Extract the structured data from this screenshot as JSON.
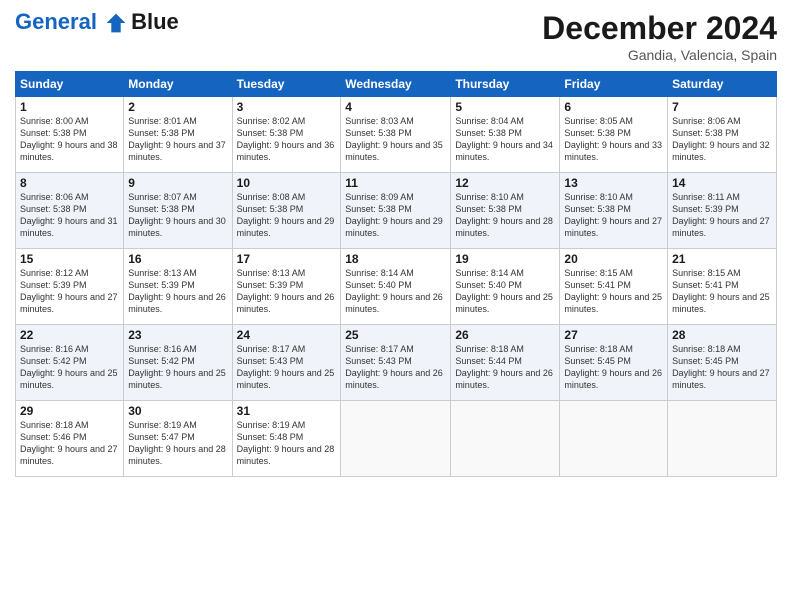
{
  "header": {
    "logo_line1": "General",
    "logo_line2": "Blue",
    "main_title": "December 2024",
    "subtitle": "Gandia, Valencia, Spain"
  },
  "calendar": {
    "days_of_week": [
      "Sunday",
      "Monday",
      "Tuesday",
      "Wednesday",
      "Thursday",
      "Friday",
      "Saturday"
    ],
    "weeks": [
      [
        {
          "day": "",
          "empty": true
        },
        {
          "day": "",
          "empty": true
        },
        {
          "day": "",
          "empty": true
        },
        {
          "day": "",
          "empty": true
        },
        {
          "day": "",
          "empty": true
        },
        {
          "day": "",
          "empty": true
        },
        {
          "day": "",
          "empty": true
        }
      ],
      [
        {
          "day": "1",
          "sunrise": "8:00 AM",
          "sunset": "5:38 PM",
          "daylight": "9 hours and 38 minutes."
        },
        {
          "day": "2",
          "sunrise": "8:01 AM",
          "sunset": "5:38 PM",
          "daylight": "9 hours and 37 minutes."
        },
        {
          "day": "3",
          "sunrise": "8:02 AM",
          "sunset": "5:38 PM",
          "daylight": "9 hours and 36 minutes."
        },
        {
          "day": "4",
          "sunrise": "8:03 AM",
          "sunset": "5:38 PM",
          "daylight": "9 hours and 35 minutes."
        },
        {
          "day": "5",
          "sunrise": "8:04 AM",
          "sunset": "5:38 PM",
          "daylight": "9 hours and 34 minutes."
        },
        {
          "day": "6",
          "sunrise": "8:05 AM",
          "sunset": "5:38 PM",
          "daylight": "9 hours and 33 minutes."
        },
        {
          "day": "7",
          "sunrise": "8:06 AM",
          "sunset": "5:38 PM",
          "daylight": "9 hours and 32 minutes."
        }
      ],
      [
        {
          "day": "8",
          "sunrise": "8:06 AM",
          "sunset": "5:38 PM",
          "daylight": "9 hours and 31 minutes."
        },
        {
          "day": "9",
          "sunrise": "8:07 AM",
          "sunset": "5:38 PM",
          "daylight": "9 hours and 30 minutes."
        },
        {
          "day": "10",
          "sunrise": "8:08 AM",
          "sunset": "5:38 PM",
          "daylight": "9 hours and 29 minutes."
        },
        {
          "day": "11",
          "sunrise": "8:09 AM",
          "sunset": "5:38 PM",
          "daylight": "9 hours and 29 minutes."
        },
        {
          "day": "12",
          "sunrise": "8:10 AM",
          "sunset": "5:38 PM",
          "daylight": "9 hours and 28 minutes."
        },
        {
          "day": "13",
          "sunrise": "8:10 AM",
          "sunset": "5:38 PM",
          "daylight": "9 hours and 27 minutes."
        },
        {
          "day": "14",
          "sunrise": "8:11 AM",
          "sunset": "5:39 PM",
          "daylight": "9 hours and 27 minutes."
        }
      ],
      [
        {
          "day": "15",
          "sunrise": "8:12 AM",
          "sunset": "5:39 PM",
          "daylight": "9 hours and 27 minutes."
        },
        {
          "day": "16",
          "sunrise": "8:13 AM",
          "sunset": "5:39 PM",
          "daylight": "9 hours and 26 minutes."
        },
        {
          "day": "17",
          "sunrise": "8:13 AM",
          "sunset": "5:39 PM",
          "daylight": "9 hours and 26 minutes."
        },
        {
          "day": "18",
          "sunrise": "8:14 AM",
          "sunset": "5:40 PM",
          "daylight": "9 hours and 26 minutes."
        },
        {
          "day": "19",
          "sunrise": "8:14 AM",
          "sunset": "5:40 PM",
          "daylight": "9 hours and 25 minutes."
        },
        {
          "day": "20",
          "sunrise": "8:15 AM",
          "sunset": "5:41 PM",
          "daylight": "9 hours and 25 minutes."
        },
        {
          "day": "21",
          "sunrise": "8:15 AM",
          "sunset": "5:41 PM",
          "daylight": "9 hours and 25 minutes."
        }
      ],
      [
        {
          "day": "22",
          "sunrise": "8:16 AM",
          "sunset": "5:42 PM",
          "daylight": "9 hours and 25 minutes."
        },
        {
          "day": "23",
          "sunrise": "8:16 AM",
          "sunset": "5:42 PM",
          "daylight": "9 hours and 25 minutes."
        },
        {
          "day": "24",
          "sunrise": "8:17 AM",
          "sunset": "5:43 PM",
          "daylight": "9 hours and 25 minutes."
        },
        {
          "day": "25",
          "sunrise": "8:17 AM",
          "sunset": "5:43 PM",
          "daylight": "9 hours and 26 minutes."
        },
        {
          "day": "26",
          "sunrise": "8:18 AM",
          "sunset": "5:44 PM",
          "daylight": "9 hours and 26 minutes."
        },
        {
          "day": "27",
          "sunrise": "8:18 AM",
          "sunset": "5:45 PM",
          "daylight": "9 hours and 26 minutes."
        },
        {
          "day": "28",
          "sunrise": "8:18 AM",
          "sunset": "5:45 PM",
          "daylight": "9 hours and 27 minutes."
        }
      ],
      [
        {
          "day": "29",
          "sunrise": "8:18 AM",
          "sunset": "5:46 PM",
          "daylight": "9 hours and 27 minutes."
        },
        {
          "day": "30",
          "sunrise": "8:19 AM",
          "sunset": "5:47 PM",
          "daylight": "9 hours and 28 minutes."
        },
        {
          "day": "31",
          "sunrise": "8:19 AM",
          "sunset": "5:48 PM",
          "daylight": "9 hours and 28 minutes."
        },
        {
          "day": "",
          "empty": true
        },
        {
          "day": "",
          "empty": true
        },
        {
          "day": "",
          "empty": true
        },
        {
          "day": "",
          "empty": true
        }
      ]
    ]
  }
}
